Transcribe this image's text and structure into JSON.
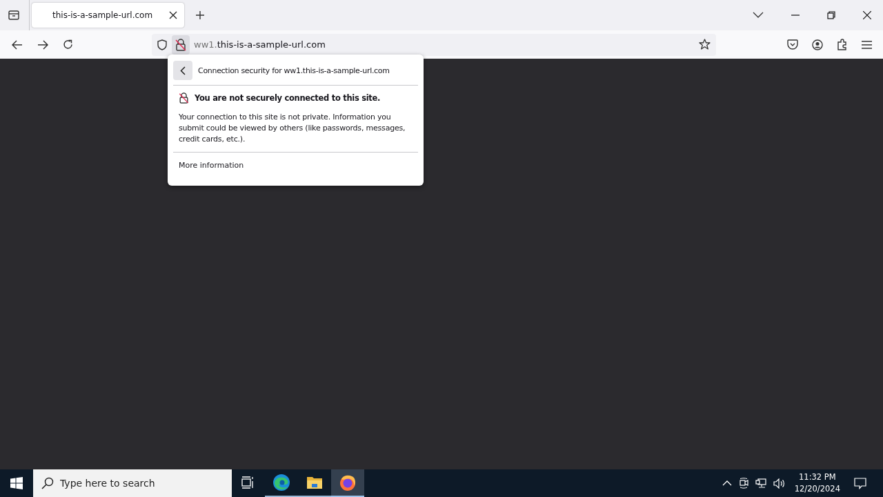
{
  "tabs": [
    {
      "title": "this-is-a-sample-url.com",
      "selected": true
    }
  ],
  "address_bar": {
    "url_prefix": "ww1.",
    "url_domain": "this-is-a-sample-url.com"
  },
  "security_panel": {
    "title": "Connection security for ww1.this-is-a-sample-url.com",
    "heading": "You are not securely connected to this site.",
    "description": "Your connection to this site is not private. Information you submit could be viewed by others (like passwords, messages, credit cards, etc.).",
    "link": "More information"
  },
  "taskbar": {
    "search_placeholder": "Type here to search",
    "apps": [
      {
        "kind": "taskview",
        "running": false,
        "selected": false
      },
      {
        "kind": "edge",
        "running": true,
        "selected": false
      },
      {
        "kind": "explorer",
        "running": true,
        "selected": false
      },
      {
        "kind": "firefox",
        "running": true,
        "selected": true
      }
    ],
    "time": "11:32 PM",
    "date": "12/20/2024"
  }
}
